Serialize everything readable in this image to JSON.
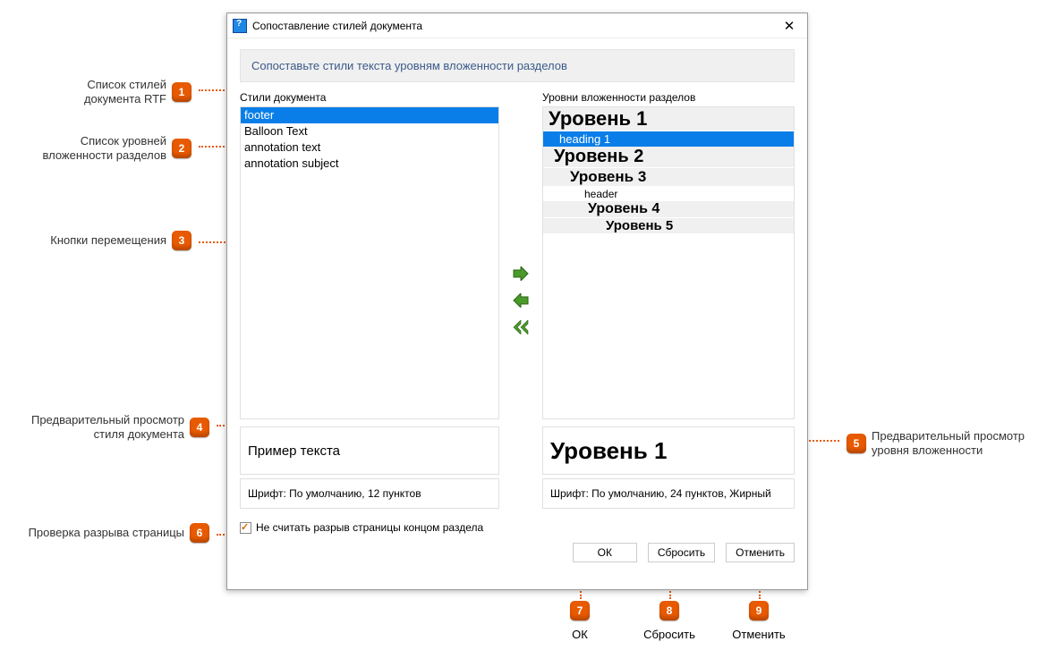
{
  "window": {
    "title": "Сопоставление стилей документа"
  },
  "banner": "Сопоставьте стили текста уровням вложенности разделов",
  "left_column_label": "Стили документа",
  "right_column_label": "Уровни вложенности разделов",
  "styles": {
    "s0": "footer",
    "s1": "Balloon Text",
    "s2": "annotation text",
    "s3": "annotation subject"
  },
  "levels": {
    "l1": "Уровень 1",
    "heading1": "heading 1",
    "l2": "Уровень 2",
    "l3": "Уровень 3",
    "header": "header",
    "l4": "Уровень 4",
    "l5": "Уровень 5"
  },
  "preview_left": "Пример текста",
  "preview_right": "Уровень 1",
  "font_left": "Шрифт: По умолчанию, 12 пунктов",
  "font_right": "Шрифт: По умолчанию, 24 пунктов, Жирный",
  "checkbox_label": "Не считать разрыв страницы концом раздела",
  "buttons": {
    "ok": "ОК",
    "reset": "Сбросить",
    "cancel": "Отменить"
  },
  "callouts": {
    "c1": "Список стилей\nдокумента RTF",
    "c2": "Список уровней\nвложенности разделов",
    "c3": "Кнопки перемещения",
    "c4": "Предварительный просмотр\nстиля документа",
    "c5": "Предварительный просмотр\nуровня вложенности",
    "c6": "Проверка разрыва страницы",
    "c7": "ОК",
    "c8": "Сбросить",
    "c9": "Отменить"
  },
  "nums": {
    "n1": "1",
    "n2": "2",
    "n3": "3",
    "n4": "4",
    "n5": "5",
    "n6": "6",
    "n7": "7",
    "n8": "8",
    "n9": "9"
  }
}
